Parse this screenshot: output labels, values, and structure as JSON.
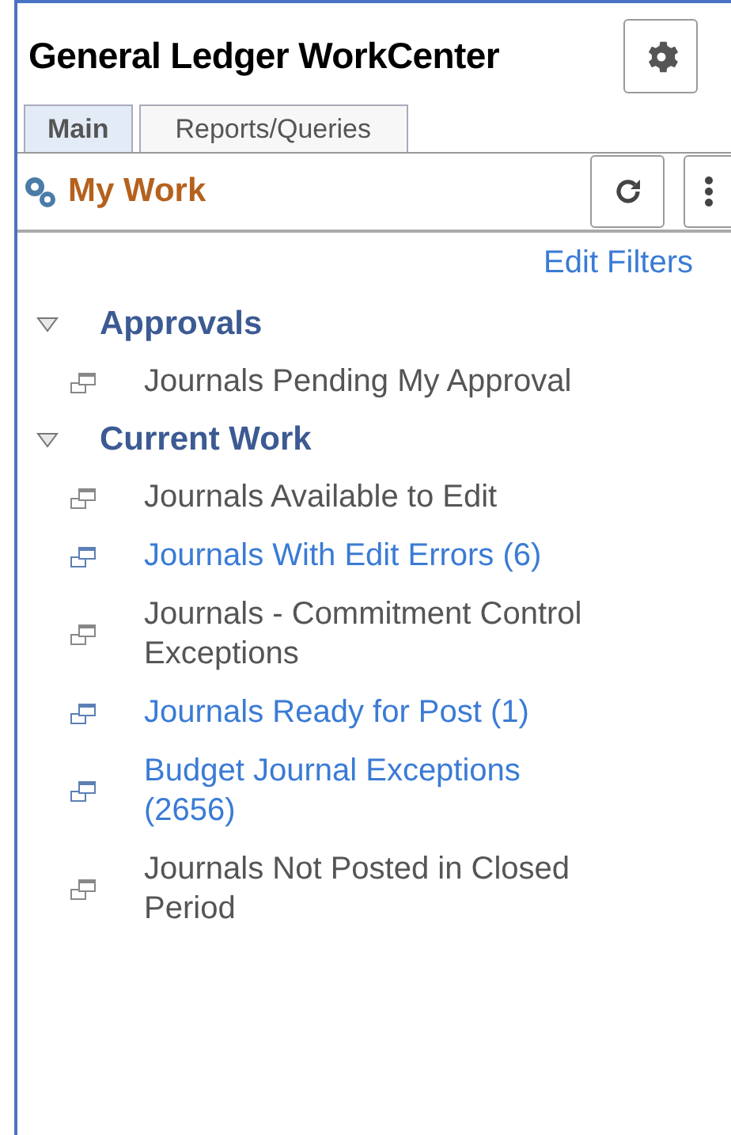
{
  "title": "General Ledger WorkCenter",
  "tabs": [
    {
      "label": "Main",
      "selected": true
    },
    {
      "label": "Reports/Queries",
      "selected": false
    }
  ],
  "pagelet": {
    "title": "My Work",
    "edit_filters": "Edit Filters"
  },
  "sections": [
    {
      "title": "Approvals",
      "expanded": true,
      "items": [
        {
          "label": "Journals Pending My Approval",
          "linked": false
        }
      ]
    },
    {
      "title": "Current Work",
      "expanded": true,
      "items": [
        {
          "label": "Journals Available to Edit",
          "linked": false
        },
        {
          "label": "Journals With Edit Errors (6)",
          "linked": true
        },
        {
          "label": "Journals - Commitment Control Exceptions",
          "linked": false
        },
        {
          "label": "Journals Ready for Post (1)",
          "linked": true
        },
        {
          "label": "Budget Journal Exceptions (2656)",
          "linked": true
        },
        {
          "label": "Journals Not Posted in Closed Period",
          "linked": false
        }
      ]
    }
  ]
}
